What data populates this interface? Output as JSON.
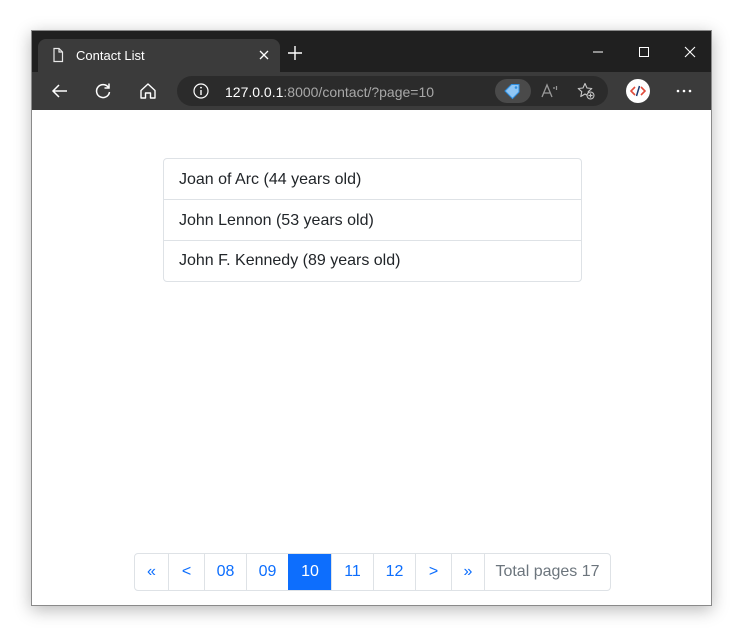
{
  "browser": {
    "tab": {
      "title": "Contact List"
    },
    "address": {
      "host": "127.0.0.1",
      "rest": ":8000/contact/?page=10"
    }
  },
  "contacts": [
    {
      "label": "Joan of Arc (44 years old)"
    },
    {
      "label": "John Lennon (53 years old)"
    },
    {
      "label": "John F. Kennedy (89 years old)"
    }
  ],
  "pagination": {
    "first": "«",
    "prev": "<",
    "pages": [
      "08",
      "09",
      "10",
      "11",
      "12"
    ],
    "current": "10",
    "next": ">",
    "last": "»",
    "total": "Total pages 17"
  },
  "colors": {
    "accent": "#0d6efd",
    "border": "#dee2e6",
    "muted": "#6c757d",
    "titlebar": "#202020",
    "toolbar": "#3b3b3b"
  },
  "icons": {
    "tab": "page-icon",
    "close": "close-icon",
    "new_tab": "plus-icon",
    "minimize": "minimize-icon",
    "maximize": "maximize-icon",
    "window_close": "close-icon",
    "back": "back-arrow-icon",
    "refresh": "refresh-icon",
    "home": "home-icon",
    "info": "info-icon",
    "tag": "tag-icon",
    "read_aloud": "read-aloud-icon",
    "favorites": "add-favorite-icon",
    "extension": "code-extension-icon",
    "menu": "more-icon"
  }
}
